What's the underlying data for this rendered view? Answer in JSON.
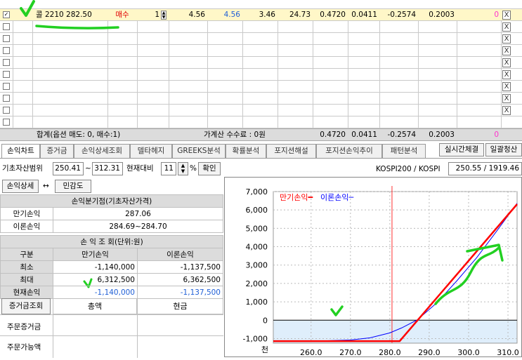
{
  "grid": {
    "row1": {
      "checked": "✓",
      "name": "콜 2210 282.50",
      "side": "매수",
      "qty": "1",
      "c1": "4.56",
      "c2": "4.56",
      "c3": "3.46",
      "c4": "24.73",
      "c5": "0.4720",
      "c6": "0.0411",
      "c7": "-0.2574",
      "c8": "0.2003",
      "c9": "0"
    },
    "empty_rows": 9,
    "close_glyph": "X",
    "summary": {
      "label": "합계(옵션 매도: 0, 매수:1)",
      "fee": "가계산 수수료 : 0원",
      "c5": "0.4720",
      "c6": "0.0411",
      "c7": "-0.2574",
      "c8": "0.2003",
      "c9": "0"
    }
  },
  "tabs": [
    "손익차트",
    "증거금",
    "손익상세조회",
    "델타헤지",
    "GREEKS분석",
    "확률분석",
    "포지션해설",
    "포지션손익추이",
    "패턴분석"
  ],
  "buttons": {
    "realtime": "실시간체결",
    "clear_all": "일괄청산",
    "confirm": "확인",
    "detail": "손익상세",
    "sensitivity": "민감도",
    "margin_lookup": "증거금조회"
  },
  "controls": {
    "range_label": "기초자산범위",
    "range_from": "250.41",
    "range_to": "312.31",
    "tilde": "~",
    "vs_label": "현재대비",
    "vs_value": "11",
    "percent": "%",
    "index_label": "KOSPI200 / KOSPI",
    "index_value": "250.55 / 1919.46",
    "arrow": "↔"
  },
  "breakeven": {
    "title": "손익분기점(기초자산가격)",
    "rows": [
      {
        "label": "만기손익",
        "value": "287.06"
      },
      {
        "label": "이론손익",
        "value": "284.69~284.70"
      }
    ]
  },
  "pnl": {
    "title": "손 익 조 회(단위:원)",
    "headers": [
      "구분",
      "만기손익",
      "이론손익"
    ],
    "rows": [
      {
        "label": "최소",
        "exp": "-1,140,000",
        "theo": "-1,137,500"
      },
      {
        "label": "최대",
        "exp": "6,312,500",
        "theo": "6,362,500"
      },
      {
        "label": "현재손익",
        "exp": "-1,140,000",
        "theo": "-1,137,500"
      }
    ]
  },
  "margin": {
    "headers": [
      "총액",
      "현금"
    ],
    "rows": [
      "주문증거금",
      "주문가능액"
    ]
  },
  "chart_data": {
    "type": "line",
    "legend": [
      "만기손익",
      "이론손익"
    ],
    "x_unit_label": "천",
    "xlim": [
      250.41,
      312.31
    ],
    "ylim": [
      -1250,
      7000
    ],
    "x_ticks": [
      260.0,
      270.0,
      280.0,
      290.0,
      300.0,
      310.0
    ],
    "y_ticks": [
      -1000,
      0,
      1000,
      2000,
      3000,
      4000,
      5000,
      6000,
      7000
    ],
    "current_price": 280.55,
    "series": [
      {
        "name": "만기손익",
        "color": "#ff0000",
        "x": [
          250.41,
          282.5,
          312.31
        ],
        "y": [
          -1140,
          -1140,
          6312.5
        ]
      },
      {
        "name": "이론손익",
        "color": "#0000ff",
        "x": [
          250.41,
          262.0,
          270.0,
          275.0,
          280.0,
          283.0,
          287.0,
          292.0,
          297.0,
          302.0,
          307.0,
          312.31
        ],
        "y": [
          -1137.5,
          -1130,
          -1080,
          -960,
          -690,
          -420,
          20,
          960,
          2140,
          3390,
          4810,
          6362.5
        ]
      }
    ]
  }
}
